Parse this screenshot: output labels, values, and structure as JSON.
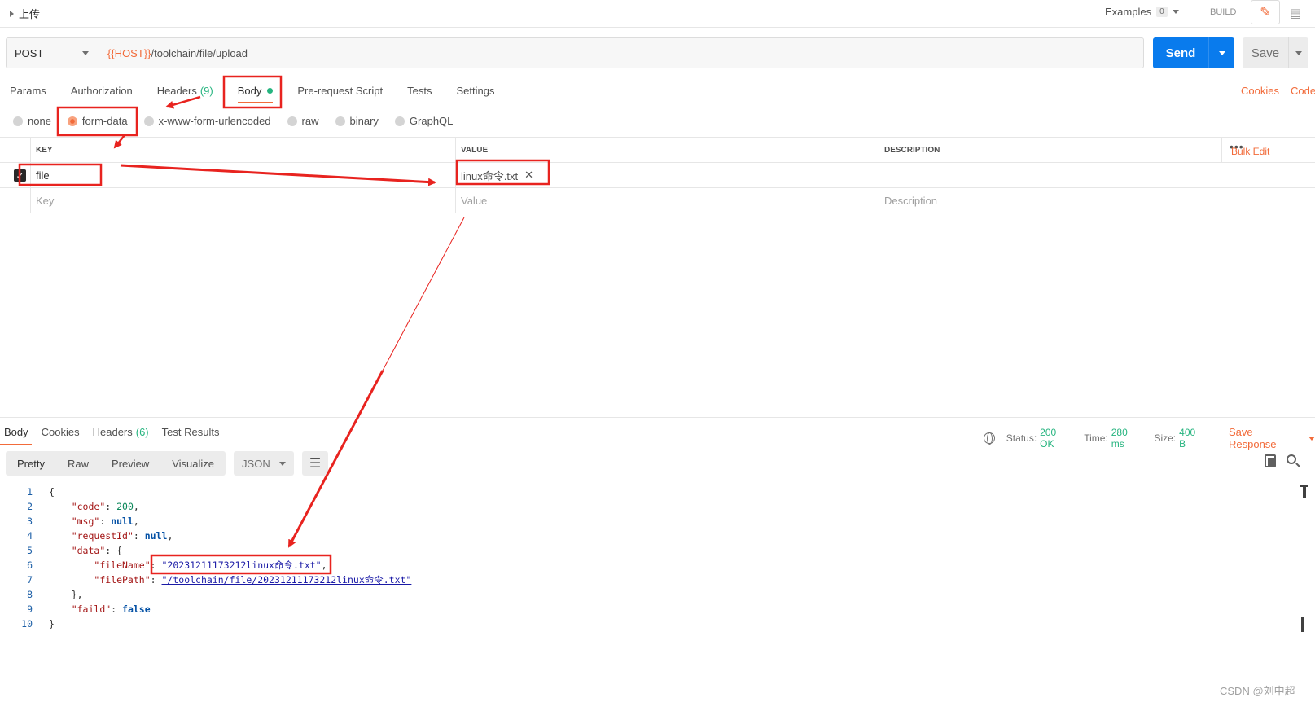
{
  "request": {
    "title": "上传",
    "examples_label": "Examples",
    "examples_count": "0",
    "build_label": "BUILD",
    "method": "POST",
    "url_var": "{{HOST}}",
    "url_path": "/toolchain/file/upload",
    "send_label": "Send",
    "save_label": "Save"
  },
  "req_tabs": {
    "params": "Params",
    "authorization": "Authorization",
    "headers": "Headers",
    "headers_count": "(9)",
    "body": "Body",
    "prerequest": "Pre-request Script",
    "tests": "Tests",
    "settings": "Settings",
    "cookies": "Cookies",
    "code": "Code"
  },
  "body_types": {
    "none": "none",
    "form_data": "form-data",
    "urlencoded": "x-www-form-urlencoded",
    "raw": "raw",
    "binary": "binary",
    "graphql": "GraphQL",
    "selected": "form-data"
  },
  "kv": {
    "headers": {
      "key": "KEY",
      "value": "VALUE",
      "description": "DESCRIPTION"
    },
    "more": "•••",
    "bulk_edit": "Bulk Edit",
    "rows": [
      {
        "checked": true,
        "key": "file",
        "value": "linux命令.txt"
      }
    ],
    "placeholder": {
      "key": "Key",
      "value": "Value",
      "description": "Description"
    }
  },
  "response": {
    "tabs": {
      "body": "Body",
      "cookies": "Cookies",
      "headers": "Headers",
      "headers_count": "(6)",
      "tests": "Test Results"
    },
    "status_label": "Status:",
    "status_value": "200 OK",
    "time_label": "Time:",
    "time_value": "280 ms",
    "size_label": "Size:",
    "size_value": "400 B",
    "save_response": "Save Response",
    "view_modes": {
      "pretty": "Pretty",
      "raw": "Raw",
      "preview": "Preview",
      "visualize": "Visualize"
    },
    "format": "JSON"
  },
  "code": {
    "line_numbers": [
      "1",
      "2",
      "3",
      "4",
      "5",
      "6",
      "7",
      "8",
      "9",
      "10"
    ],
    "l1": "{",
    "code_key": "\"code\"",
    "code_val": "200",
    "msg_key": "\"msg\"",
    "msg_val": "null",
    "req_key": "\"requestId\"",
    "req_val": "null",
    "data_key": "\"data\"",
    "data_open": "{",
    "fn_key": "\"fileName\"",
    "fn_val": "\"20231211173212linux命令.txt\"",
    "fp_key": "\"filePath\"",
    "fp_val": "\"/toolchain/file/20231211173212linux命令.txt\"",
    "data_close": "},",
    "faild_key": "\"faild\"",
    "faild_val": "false",
    "l10": "}"
  },
  "watermark": "CSDN @刘中超",
  "colors": {
    "accent": "#f26b3a",
    "send": "#097bed",
    "ok": "#26b47f",
    "annotation": "#e8231f"
  },
  "icons": [
    "caret-right-icon",
    "pencil-icon",
    "comment-icon",
    "globe-icon",
    "wrap-icon",
    "copy-icon",
    "search-icon",
    "close-icon",
    "chevron-down-icon"
  ]
}
